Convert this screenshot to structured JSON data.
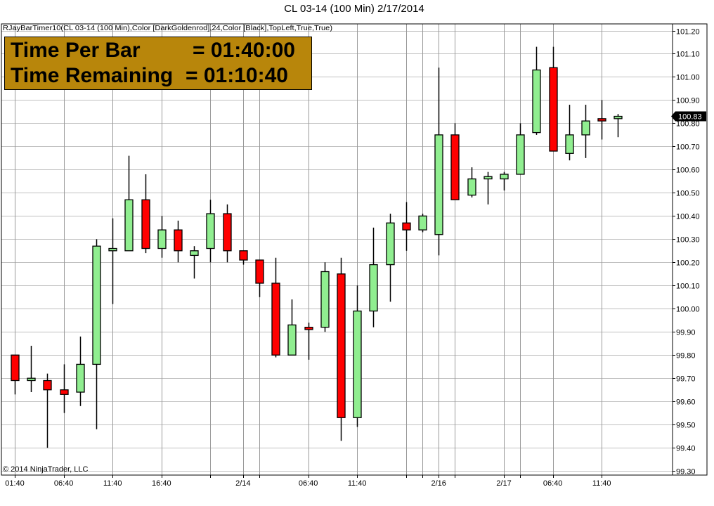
{
  "chart_title": "CL 03-14 (100 Min)  2/17/2014",
  "indicator_label": "RJayBarTimer10(CL 03-14 (100 Min),Color [DarkGoldenrod],24,Color [Black],TopLeft,True,True)",
  "copyright": "© 2014 NinjaTrader, LLC",
  "timer": {
    "per_bar_label": "Time Per Bar",
    "per_bar_value": "= 01:40:00",
    "remaining_label": "Time Remaining",
    "remaining_value": "= 01:10:40",
    "background_color": "#B8860B"
  },
  "current_price_label": "100.83",
  "colors": {
    "up": "#90EE90",
    "down": "#FF0000",
    "wick": "#000000",
    "grid": "#C0C0C0"
  },
  "chart_data": {
    "type": "candlestick",
    "title": "CL 03-14 (100 Min)  2/17/2014",
    "ylim": [
      99.27,
      101.23
    ],
    "y_ticks": [
      "101.20",
      "101.10",
      "101.00",
      "100.90",
      "100.80",
      "100.70",
      "100.60",
      "100.50",
      "100.40",
      "100.30",
      "100.20",
      "100.10",
      "100.00",
      "99.90",
      "99.80",
      "99.70",
      "99.60",
      "99.50",
      "99.40",
      "99.30"
    ],
    "x_tick_labels": [
      "01:40",
      "06:40",
      "11:40",
      "16:40",
      "2/14",
      "06:40",
      "11:40",
      "2/16",
      "2/17",
      "06:40",
      "11:40"
    ],
    "x_tick_bar_index": [
      0,
      3,
      6,
      9,
      14,
      18,
      21,
      26,
      30,
      33,
      36
    ],
    "vertical_gridline_bar_index": [
      0,
      3,
      6,
      9,
      12,
      14,
      15,
      18,
      21,
      24,
      25,
      26,
      27,
      30,
      31,
      33,
      36
    ],
    "candles": [
      {
        "open": 99.8,
        "high": 99.8,
        "low": 99.63,
        "close": 99.69
      },
      {
        "open": 99.69,
        "high": 99.84,
        "low": 99.64,
        "close": 99.7
      },
      {
        "open": 99.69,
        "high": 99.72,
        "low": 99.4,
        "close": 99.65
      },
      {
        "open": 99.65,
        "high": 99.76,
        "low": 99.55,
        "close": 99.63
      },
      {
        "open": 99.64,
        "high": 99.88,
        "low": 99.58,
        "close": 99.76
      },
      {
        "open": 99.76,
        "high": 100.3,
        "low": 99.48,
        "close": 100.27
      },
      {
        "open": 100.25,
        "high": 100.39,
        "low": 100.02,
        "close": 100.26
      },
      {
        "open": 100.25,
        "high": 100.66,
        "low": 100.25,
        "close": 100.47
      },
      {
        "open": 100.47,
        "high": 100.58,
        "low": 100.24,
        "close": 100.26
      },
      {
        "open": 100.26,
        "high": 100.4,
        "low": 100.22,
        "close": 100.34
      },
      {
        "open": 100.34,
        "high": 100.38,
        "low": 100.2,
        "close": 100.25
      },
      {
        "open": 100.23,
        "high": 100.27,
        "low": 100.13,
        "close": 100.25
      },
      {
        "open": 100.26,
        "high": 100.47,
        "low": 100.2,
        "close": 100.41
      },
      {
        "open": 100.41,
        "high": 100.45,
        "low": 100.2,
        "close": 100.25
      },
      {
        "open": 100.25,
        "high": 100.25,
        "low": 100.19,
        "close": 100.21
      },
      {
        "open": 100.21,
        "high": 100.21,
        "low": 100.05,
        "close": 100.11
      },
      {
        "open": 100.11,
        "high": 100.22,
        "low": 99.79,
        "close": 99.8
      },
      {
        "open": 99.8,
        "high": 100.04,
        "low": 99.8,
        "close": 99.93
      },
      {
        "open": 99.92,
        "high": 99.94,
        "low": 99.78,
        "close": 99.91
      },
      {
        "open": 99.92,
        "high": 100.2,
        "low": 99.9,
        "close": 100.16
      },
      {
        "open": 100.15,
        "high": 100.22,
        "low": 99.43,
        "close": 99.53
      },
      {
        "open": 99.53,
        "high": 100.1,
        "low": 99.49,
        "close": 99.99
      },
      {
        "open": 99.99,
        "high": 100.35,
        "low": 99.92,
        "close": 100.19
      },
      {
        "open": 100.19,
        "high": 100.41,
        "low": 100.03,
        "close": 100.37
      },
      {
        "open": 100.37,
        "high": 100.46,
        "low": 100.25,
        "close": 100.34
      },
      {
        "open": 100.34,
        "high": 100.41,
        "low": 100.33,
        "close": 100.4
      },
      {
        "open": 100.32,
        "high": 101.04,
        "low": 100.23,
        "close": 100.75
      },
      {
        "open": 100.75,
        "high": 100.8,
        "low": 100.47,
        "close": 100.47
      },
      {
        "open": 100.49,
        "high": 100.61,
        "low": 100.48,
        "close": 100.56
      },
      {
        "open": 100.56,
        "high": 100.59,
        "low": 100.45,
        "close": 100.57
      },
      {
        "open": 100.56,
        "high": 100.59,
        "low": 100.51,
        "close": 100.58
      },
      {
        "open": 100.58,
        "high": 100.8,
        "low": 100.58,
        "close": 100.75
      },
      {
        "open": 100.76,
        "high": 101.13,
        "low": 100.75,
        "close": 101.03
      },
      {
        "open": 101.04,
        "high": 101.13,
        "low": 100.68,
        "close": 100.68
      },
      {
        "open": 100.67,
        "high": 100.88,
        "low": 100.64,
        "close": 100.75
      },
      {
        "open": 100.75,
        "high": 100.88,
        "low": 100.65,
        "close": 100.81
      },
      {
        "open": 100.82,
        "high": 100.9,
        "low": 100.73,
        "close": 100.81
      },
      {
        "open": 100.82,
        "high": 100.84,
        "low": 100.74,
        "close": 100.83
      }
    ]
  }
}
